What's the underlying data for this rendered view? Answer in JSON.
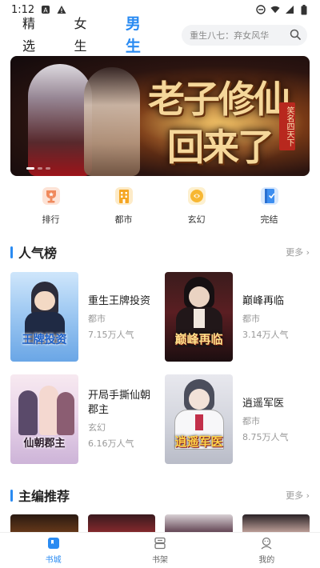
{
  "status_bar": {
    "time": "1:12",
    "icons": [
      "notification-a-icon",
      "alert-icon",
      "dnd-icon",
      "wifi-icon",
      "signal-icon",
      "battery-icon"
    ]
  },
  "nav": {
    "tabs": [
      {
        "label": "精选",
        "active": false
      },
      {
        "label": "女生",
        "active": false
      },
      {
        "label": "男生",
        "active": true
      }
    ],
    "search_placeholder": "重生八七：弃女风华",
    "accent_color": "#2a8bf2"
  },
  "banner": {
    "title_line1": "老子修仙",
    "title_line2": "回来了",
    "seal_text": "笑名四天下",
    "page_count": 3,
    "active_page": 1
  },
  "categories": [
    {
      "label": "排行",
      "icon": "trophy-icon",
      "color": "#f08a5d"
    },
    {
      "label": "都市",
      "icon": "city-building-icon",
      "color": "#f5a623"
    },
    {
      "label": "玄幻",
      "icon": "magic-orb-icon",
      "color": "#f7b733"
    },
    {
      "label": "完结",
      "icon": "book-complete-icon",
      "color": "#3d8ef0"
    }
  ],
  "popular": {
    "title": "人气榜",
    "more": "更多 ›",
    "books": [
      {
        "title": "重生王牌投资",
        "genre": "都市",
        "popularity": "7.15万人气",
        "cover_text": "王牌投资"
      },
      {
        "title": "巅峰再临",
        "genre": "都市",
        "popularity": "3.14万人气",
        "cover_text": "巅峰再临"
      },
      {
        "title": "开局手撕仙朝郡主",
        "genre": "玄幻",
        "popularity": "6.16万人气",
        "cover_text": "仙朝郡主"
      },
      {
        "title": "逍遥军医",
        "genre": "都市",
        "popularity": "8.75万人气",
        "cover_text": "逍遥军医"
      }
    ]
  },
  "editor_picks": {
    "title": "主编推荐",
    "more": "更多 ›"
  },
  "bottom_nav": [
    {
      "label": "书城",
      "icon": "bookstore-icon",
      "active": true
    },
    {
      "label": "书架",
      "icon": "bookshelf-icon",
      "active": false
    },
    {
      "label": "我的",
      "icon": "profile-icon",
      "active": false
    }
  ]
}
